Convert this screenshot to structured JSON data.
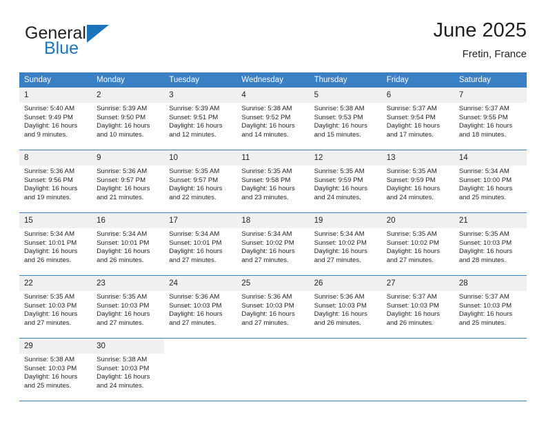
{
  "brand": {
    "name_part1": "General",
    "name_part2": "Blue",
    "icon": "triangle-logo"
  },
  "header": {
    "title": "June 2025",
    "location": "Fretin, France"
  },
  "calendar": {
    "weekday_headers": [
      "Sunday",
      "Monday",
      "Tuesday",
      "Wednesday",
      "Thursday",
      "Friday",
      "Saturday"
    ],
    "accent_color": "#3b7fc4",
    "daynum_background": "#f0f0f0",
    "weeks": [
      [
        {
          "day": "1",
          "sunrise": "Sunrise: 5:40 AM",
          "sunset": "Sunset: 9:49 PM",
          "daylight_line1": "Daylight: 16 hours",
          "daylight_line2": "and 9 minutes."
        },
        {
          "day": "2",
          "sunrise": "Sunrise: 5:39 AM",
          "sunset": "Sunset: 9:50 PM",
          "daylight_line1": "Daylight: 16 hours",
          "daylight_line2": "and 10 minutes."
        },
        {
          "day": "3",
          "sunrise": "Sunrise: 5:39 AM",
          "sunset": "Sunset: 9:51 PM",
          "daylight_line1": "Daylight: 16 hours",
          "daylight_line2": "and 12 minutes."
        },
        {
          "day": "4",
          "sunrise": "Sunrise: 5:38 AM",
          "sunset": "Sunset: 9:52 PM",
          "daylight_line1": "Daylight: 16 hours",
          "daylight_line2": "and 14 minutes."
        },
        {
          "day": "5",
          "sunrise": "Sunrise: 5:38 AM",
          "sunset": "Sunset: 9:53 PM",
          "daylight_line1": "Daylight: 16 hours",
          "daylight_line2": "and 15 minutes."
        },
        {
          "day": "6",
          "sunrise": "Sunrise: 5:37 AM",
          "sunset": "Sunset: 9:54 PM",
          "daylight_line1": "Daylight: 16 hours",
          "daylight_line2": "and 17 minutes."
        },
        {
          "day": "7",
          "sunrise": "Sunrise: 5:37 AM",
          "sunset": "Sunset: 9:55 PM",
          "daylight_line1": "Daylight: 16 hours",
          "daylight_line2": "and 18 minutes."
        }
      ],
      [
        {
          "day": "8",
          "sunrise": "Sunrise: 5:36 AM",
          "sunset": "Sunset: 9:56 PM",
          "daylight_line1": "Daylight: 16 hours",
          "daylight_line2": "and 19 minutes."
        },
        {
          "day": "9",
          "sunrise": "Sunrise: 5:36 AM",
          "sunset": "Sunset: 9:57 PM",
          "daylight_line1": "Daylight: 16 hours",
          "daylight_line2": "and 21 minutes."
        },
        {
          "day": "10",
          "sunrise": "Sunrise: 5:35 AM",
          "sunset": "Sunset: 9:57 PM",
          "daylight_line1": "Daylight: 16 hours",
          "daylight_line2": "and 22 minutes."
        },
        {
          "day": "11",
          "sunrise": "Sunrise: 5:35 AM",
          "sunset": "Sunset: 9:58 PM",
          "daylight_line1": "Daylight: 16 hours",
          "daylight_line2": "and 23 minutes."
        },
        {
          "day": "12",
          "sunrise": "Sunrise: 5:35 AM",
          "sunset": "Sunset: 9:59 PM",
          "daylight_line1": "Daylight: 16 hours",
          "daylight_line2": "and 24 minutes."
        },
        {
          "day": "13",
          "sunrise": "Sunrise: 5:35 AM",
          "sunset": "Sunset: 9:59 PM",
          "daylight_line1": "Daylight: 16 hours",
          "daylight_line2": "and 24 minutes."
        },
        {
          "day": "14",
          "sunrise": "Sunrise: 5:34 AM",
          "sunset": "Sunset: 10:00 PM",
          "daylight_line1": "Daylight: 16 hours",
          "daylight_line2": "and 25 minutes."
        }
      ],
      [
        {
          "day": "15",
          "sunrise": "Sunrise: 5:34 AM",
          "sunset": "Sunset: 10:01 PM",
          "daylight_line1": "Daylight: 16 hours",
          "daylight_line2": "and 26 minutes."
        },
        {
          "day": "16",
          "sunrise": "Sunrise: 5:34 AM",
          "sunset": "Sunset: 10:01 PM",
          "daylight_line1": "Daylight: 16 hours",
          "daylight_line2": "and 26 minutes."
        },
        {
          "day": "17",
          "sunrise": "Sunrise: 5:34 AM",
          "sunset": "Sunset: 10:01 PM",
          "daylight_line1": "Daylight: 16 hours",
          "daylight_line2": "and 27 minutes."
        },
        {
          "day": "18",
          "sunrise": "Sunrise: 5:34 AM",
          "sunset": "Sunset: 10:02 PM",
          "daylight_line1": "Daylight: 16 hours",
          "daylight_line2": "and 27 minutes."
        },
        {
          "day": "19",
          "sunrise": "Sunrise: 5:34 AM",
          "sunset": "Sunset: 10:02 PM",
          "daylight_line1": "Daylight: 16 hours",
          "daylight_line2": "and 27 minutes."
        },
        {
          "day": "20",
          "sunrise": "Sunrise: 5:35 AM",
          "sunset": "Sunset: 10:02 PM",
          "daylight_line1": "Daylight: 16 hours",
          "daylight_line2": "and 27 minutes."
        },
        {
          "day": "21",
          "sunrise": "Sunrise: 5:35 AM",
          "sunset": "Sunset: 10:03 PM",
          "daylight_line1": "Daylight: 16 hours",
          "daylight_line2": "and 28 minutes."
        }
      ],
      [
        {
          "day": "22",
          "sunrise": "Sunrise: 5:35 AM",
          "sunset": "Sunset: 10:03 PM",
          "daylight_line1": "Daylight: 16 hours",
          "daylight_line2": "and 27 minutes."
        },
        {
          "day": "23",
          "sunrise": "Sunrise: 5:35 AM",
          "sunset": "Sunset: 10:03 PM",
          "daylight_line1": "Daylight: 16 hours",
          "daylight_line2": "and 27 minutes."
        },
        {
          "day": "24",
          "sunrise": "Sunrise: 5:36 AM",
          "sunset": "Sunset: 10:03 PM",
          "daylight_line1": "Daylight: 16 hours",
          "daylight_line2": "and 27 minutes."
        },
        {
          "day": "25",
          "sunrise": "Sunrise: 5:36 AM",
          "sunset": "Sunset: 10:03 PM",
          "daylight_line1": "Daylight: 16 hours",
          "daylight_line2": "and 27 minutes."
        },
        {
          "day": "26",
          "sunrise": "Sunrise: 5:36 AM",
          "sunset": "Sunset: 10:03 PM",
          "daylight_line1": "Daylight: 16 hours",
          "daylight_line2": "and 26 minutes."
        },
        {
          "day": "27",
          "sunrise": "Sunrise: 5:37 AM",
          "sunset": "Sunset: 10:03 PM",
          "daylight_line1": "Daylight: 16 hours",
          "daylight_line2": "and 26 minutes."
        },
        {
          "day": "28",
          "sunrise": "Sunrise: 5:37 AM",
          "sunset": "Sunset: 10:03 PM",
          "daylight_line1": "Daylight: 16 hours",
          "daylight_line2": "and 25 minutes."
        }
      ],
      [
        {
          "day": "29",
          "sunrise": "Sunrise: 5:38 AM",
          "sunset": "Sunset: 10:03 PM",
          "daylight_line1": "Daylight: 16 hours",
          "daylight_line2": "and 25 minutes."
        },
        {
          "day": "30",
          "sunrise": "Sunrise: 5:38 AM",
          "sunset": "Sunset: 10:03 PM",
          "daylight_line1": "Daylight: 16 hours",
          "daylight_line2": "and 24 minutes."
        },
        null,
        null,
        null,
        null,
        null
      ]
    ]
  }
}
